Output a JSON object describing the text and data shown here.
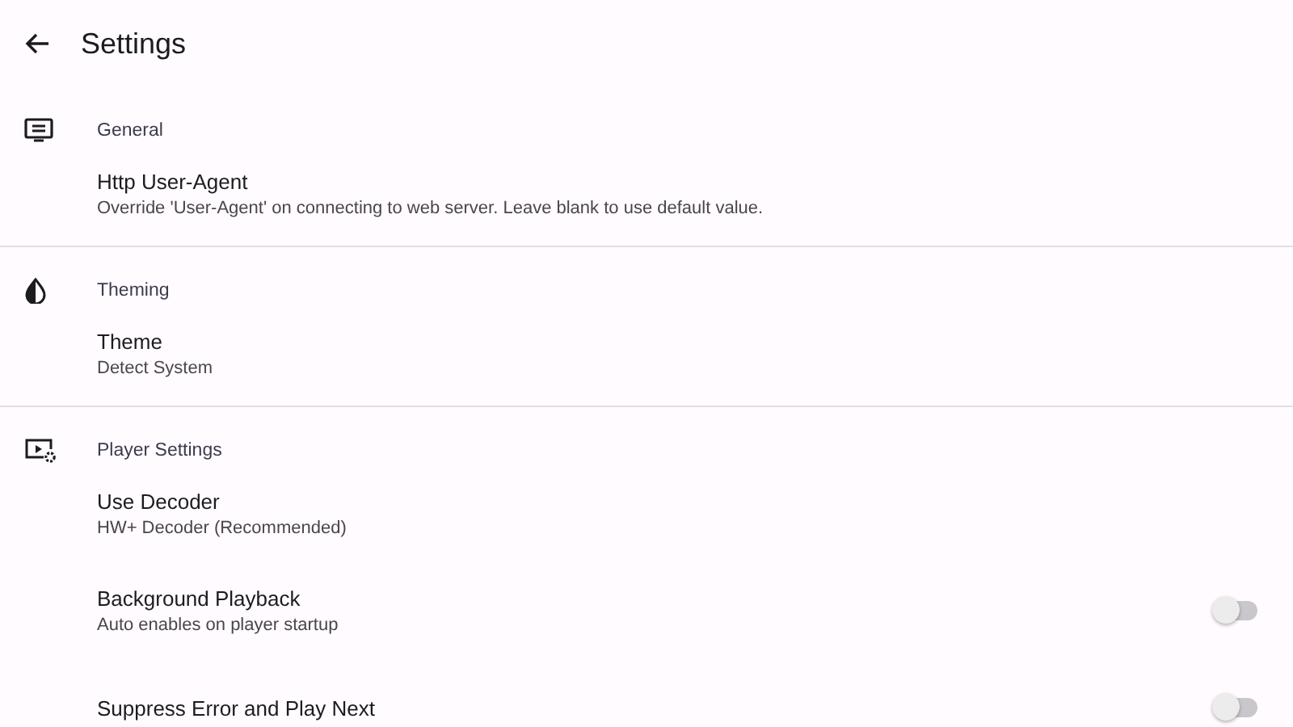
{
  "app_bar": {
    "title": "Settings"
  },
  "sections": [
    {
      "title": "General",
      "items": [
        {
          "kind": "text",
          "title": "Http User-Agent",
          "subtitle": "Override 'User-Agent' on connecting to web server. Leave blank to use default value."
        }
      ]
    },
    {
      "title": "Theming",
      "items": [
        {
          "kind": "text",
          "title": "Theme",
          "subtitle": "Detect System"
        }
      ]
    },
    {
      "title": "Player Settings",
      "items": [
        {
          "kind": "text",
          "title": "Use Decoder",
          "subtitle": "HW+ Decoder (Recommended)"
        },
        {
          "kind": "switch",
          "title": "Background Playback",
          "subtitle": "Auto enables on player startup",
          "on": false
        },
        {
          "kind": "switch",
          "title": "Suppress Error and Play Next",
          "on": false
        }
      ]
    }
  ]
}
